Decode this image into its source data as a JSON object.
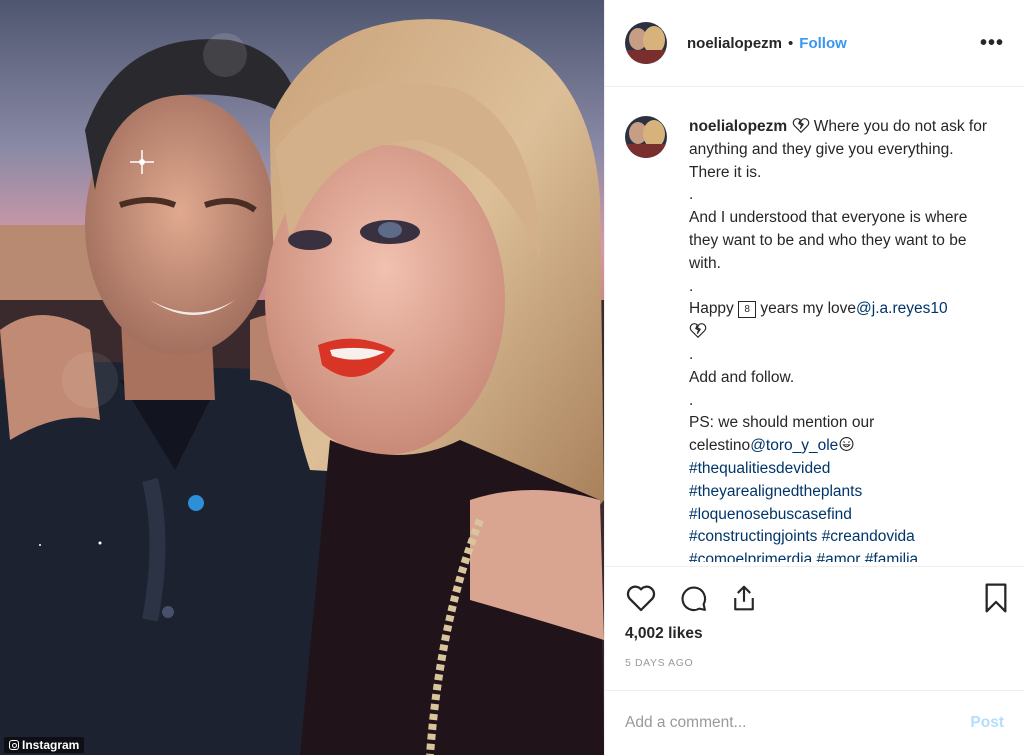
{
  "watermark": "Instagram",
  "post": {
    "username": "noelialopezm",
    "separator": "•",
    "follow_label": "Follow",
    "more_label": "•••",
    "caption": {
      "username": "noelialopezm",
      "line1": " Where you do not ask for anything and they give you everything. There it is.",
      "dot1": ".",
      "line2": "And I understood that everyone is where they want to be and who they want to be with.",
      "dot2": ".",
      "happy_pre": "Happy ",
      "happy_num": "8",
      "happy_post": " years my love",
      "mention1": "@j.a.reyes10",
      "dot3": ".",
      "line3": "Add and follow.",
      "dot4": ".",
      "line4": "PS: we should mention our celestino",
      "mention2": "@toro_y_ole",
      "hashtags": [
        "#thequalitiesdevided",
        "#theyarealignedtheplants",
        "#loquenosebuscasefind",
        "#constructingjoints",
        "#creandovida",
        "#comoelprimerdia",
        "#amor",
        "#familia"
      ]
    },
    "likes": "4,002 likes",
    "time": "5 DAYS AGO",
    "comment_placeholder": "Add a comment...",
    "post_label": "Post"
  },
  "colors": {
    "link": "#3897f0",
    "hashtag": "#003569",
    "muted": "#999999",
    "post_disabled": "#b2dffc"
  },
  "icons": [
    "heart-icon",
    "comment-icon",
    "share-icon",
    "bookmark-icon",
    "more-icon",
    "instagram-camera-icon"
  ]
}
